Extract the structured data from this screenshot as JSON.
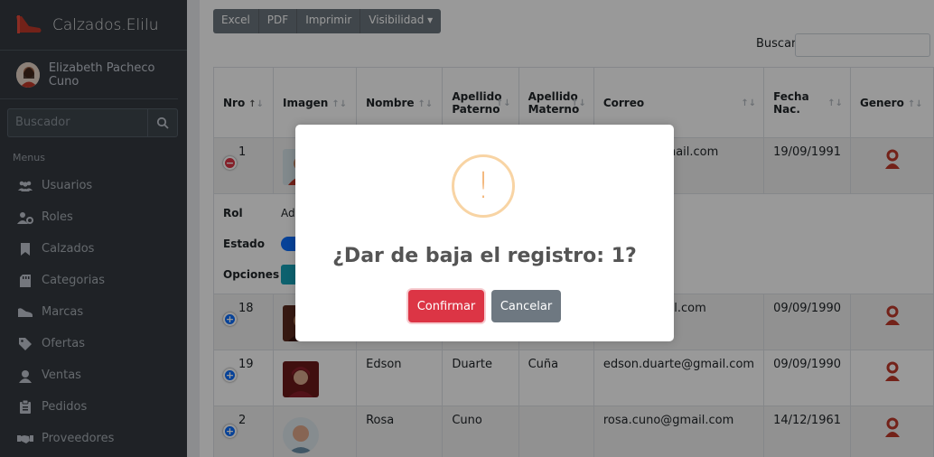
{
  "brand": {
    "name": "Calzados.Elilu"
  },
  "user": {
    "name": "Elizabeth Pacheco Cuno"
  },
  "sidebar": {
    "search_placeholder": "Buscador",
    "menu_header": "Menus",
    "items": [
      {
        "label": "Usuarios",
        "icon": "users-icon"
      },
      {
        "label": "Roles",
        "icon": "user-cog-icon"
      },
      {
        "label": "Calzados",
        "icon": "bookmark-icon"
      },
      {
        "label": "Categorias",
        "icon": "sd-card-icon"
      },
      {
        "label": "Marcas",
        "icon": "shoe-icon"
      },
      {
        "label": "Ofertas",
        "icon": "tag-icon"
      },
      {
        "label": "Ventas",
        "icon": "user-circle-icon"
      },
      {
        "label": "Pedidos",
        "icon": "clipboard-icon"
      },
      {
        "label": "Proveedores",
        "icon": "handshake-icon"
      }
    ]
  },
  "toolbar": {
    "excel": "Excel",
    "pdf": "PDF",
    "print": "Imprimir",
    "visibility": "Visibilidad"
  },
  "search": {
    "label": "Buscar:"
  },
  "table": {
    "headers": {
      "nro": "Nro",
      "imagen": "Imagen",
      "nombre": "Nombre",
      "apellido_paterno_1": "Apellido",
      "apellido_paterno_2": "Paterno",
      "apellido_materno_1": "Apellido",
      "apellido_materno_2": "Materno",
      "correo": "Correo",
      "fecha_1": "Fecha",
      "fecha_2": "Nac.",
      "genero": "Genero"
    },
    "rows": [
      {
        "nro": "1",
        "nombre": "",
        "paterno": "",
        "materno": "",
        "correo": "acheco@gmail.com",
        "fecha": "19/09/1991"
      },
      {
        "nro": "18",
        "nombre": "",
        "paterno": "",
        "materno": "",
        "correo": "erres@gmail.com",
        "fecha": "09/09/1990"
      },
      {
        "nro": "19",
        "nombre": "Edson",
        "paterno": "Duarte",
        "materno": "Cuña",
        "correo": "edson.duarte@gmail.com",
        "fecha": "09/09/1990"
      },
      {
        "nro": "2",
        "nombre": "Rosa",
        "paterno": "Cuno",
        "materno": "",
        "correo": "rosa.cuno@gmail.com",
        "fecha": "14/12/1961"
      }
    ],
    "child": {
      "rol_label": "Rol",
      "rol_value": "Adı",
      "estado_label": "Estado",
      "opciones_label": "Opciones"
    }
  },
  "modal": {
    "title": "¿Dar de baja el registro: 1?",
    "warning_mark": "!",
    "confirm": "Confirmar",
    "cancel": "Cancelar"
  }
}
